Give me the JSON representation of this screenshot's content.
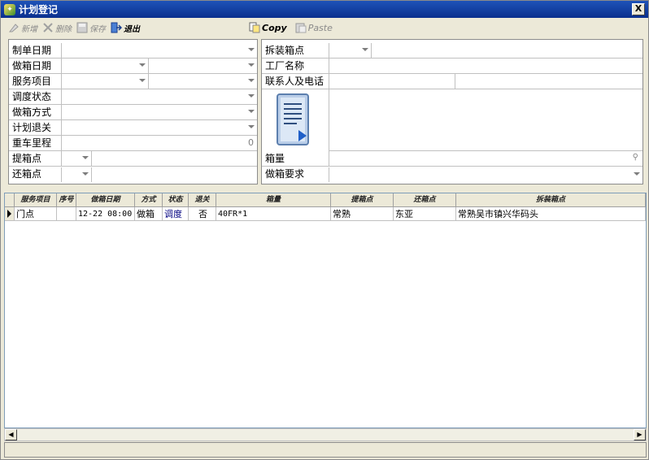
{
  "window": {
    "title": "计划登记",
    "close_glyph": "X"
  },
  "toolbar": {
    "new_label": "新增",
    "delete_label": "删除",
    "save_label": "保存",
    "exit_label": "退出",
    "copy_label": "Copy",
    "paste_label": "Paste"
  },
  "form_left": {
    "order_date": {
      "label": "制单日期",
      "value": ""
    },
    "box_date": {
      "label": "做箱日期",
      "value": ""
    },
    "service_item": {
      "label": "服务项目",
      "value": ""
    },
    "dispatch_status": {
      "label": "调度状态",
      "value": ""
    },
    "box_method": {
      "label": "做箱方式",
      "value": ""
    },
    "plan_customs": {
      "label": "计划退关",
      "value": ""
    },
    "heavy_mileage": {
      "label": "重车里程",
      "value": "0"
    },
    "pickup_point": {
      "label": "提箱点",
      "value": ""
    },
    "return_point": {
      "label": "还箱点",
      "value": ""
    }
  },
  "form_right": {
    "unpack_point": {
      "label": "拆装箱点",
      "value": ""
    },
    "factory_name": {
      "label": "工厂名称",
      "value": ""
    },
    "contact": {
      "label": "联系人及电话",
      "value": ""
    },
    "box_qty": {
      "label": "箱量",
      "value": ""
    },
    "box_requirement": {
      "label": "做箱要求",
      "value": ""
    }
  },
  "grid": {
    "columns": [
      "服务项目",
      "序号",
      "做箱日期",
      "方式",
      "状态",
      "退关",
      "箱量",
      "提箱点",
      "还箱点",
      "拆装箱点"
    ],
    "rows": [
      [
        "门点",
        "",
        "12-22 08:00",
        "做箱",
        "调度",
        "否",
        "40FR*1",
        "常熟",
        "东亚",
        "常熟吴市镇兴华码头"
      ]
    ]
  },
  "colors": {
    "title_bar": "#0a2f8e",
    "status_link": "#000080"
  }
}
